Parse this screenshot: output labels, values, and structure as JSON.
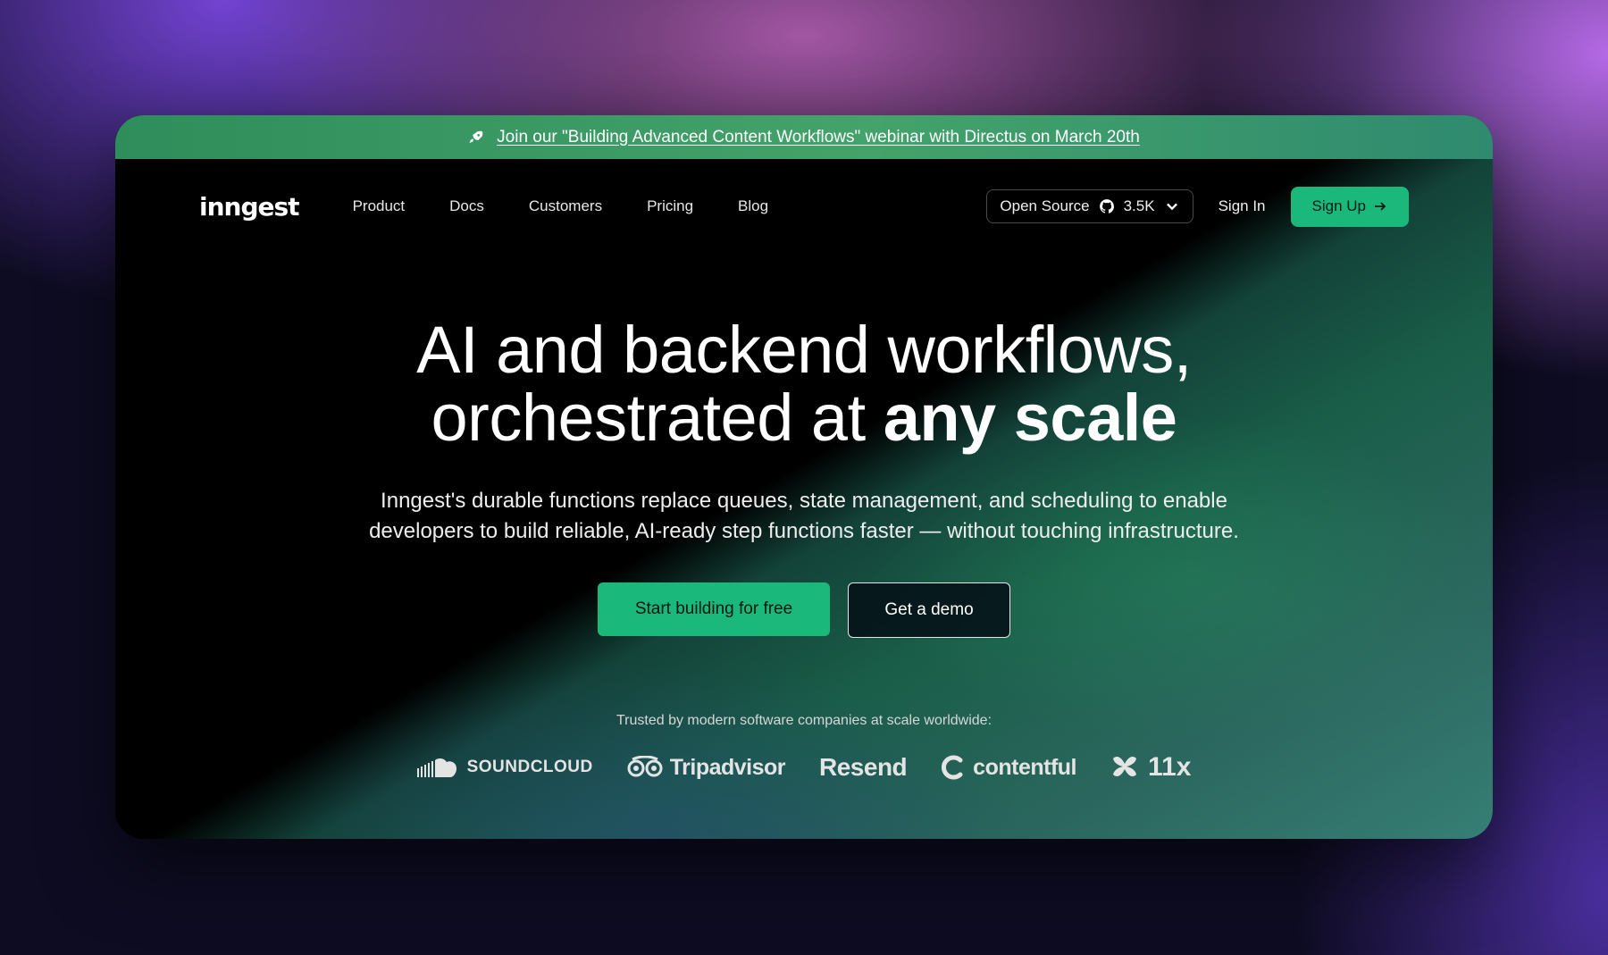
{
  "announcement": {
    "text": "Join our \"Building Advanced Content Workflows\" webinar with Directus on March 20th",
    "icon": "rocket-icon"
  },
  "nav": {
    "logo": "inngest",
    "links": [
      "Product",
      "Docs",
      "Customers",
      "Pricing",
      "Blog"
    ],
    "open_source": {
      "label": "Open Source",
      "stars": "3.5K",
      "icon": "github-icon"
    },
    "sign_in": "Sign In",
    "sign_up": "Sign Up"
  },
  "hero": {
    "headline_line1": "AI and backend workflows,",
    "headline_line2_plain": "orchestrated at ",
    "headline_line2_bold": "any scale",
    "subtitle": "Inngest's durable functions replace queues, state management, and scheduling to enable developers to build reliable, AI-ready step functions faster — without touching infrastructure.",
    "primary_cta": "Start building for free",
    "secondary_cta": "Get a demo",
    "trusted_text": "Trusted by modern software companies at scale worldwide:",
    "logos": [
      "SOUNDCLOUD",
      "Tripadvisor",
      "Resend",
      "contentful",
      "11x"
    ]
  },
  "colors": {
    "accent": "#1ab97b",
    "announcement_bg": "#3a9a63",
    "background": "#000000"
  }
}
